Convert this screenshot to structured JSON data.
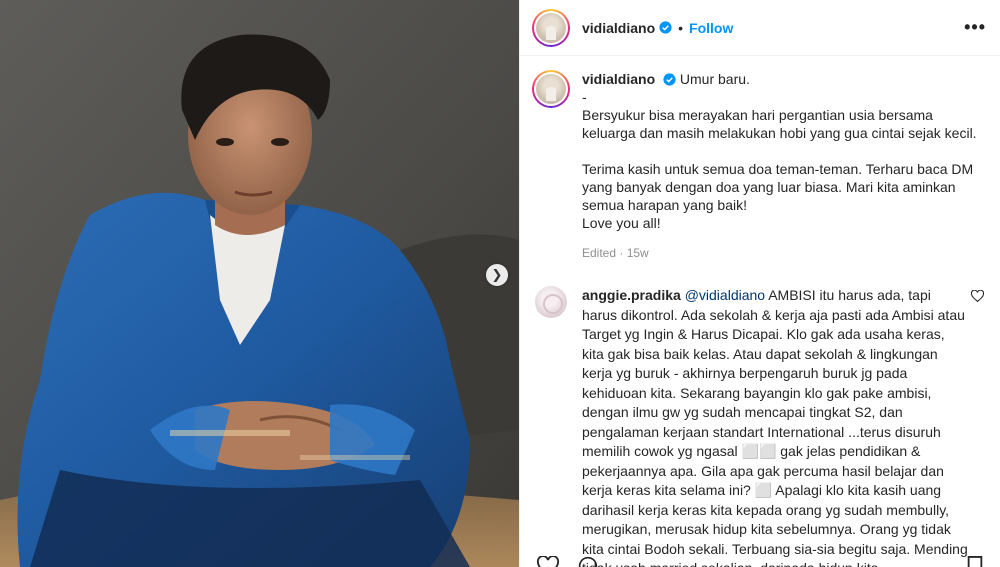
{
  "post": {
    "username": "vidialdiano",
    "follow_label": "Follow",
    "separator": "•",
    "more_label": "•••",
    "caption": {
      "first_line": "Umur baru.",
      "dash": "-",
      "para1": "Bersyukur bisa merayakan hari pergantian usia bersama keluarga dan masih melakukan hobi yang gua cintai sejak kecil.",
      "para2": "Terima kasih untuk semua doa teman-teman. Terharu baca DM yang banyak dengan doa yang luar biasa. Mari kita aminkan semua harapan yang baik!",
      "para3": "Love you all!"
    },
    "meta": "Edited · 15w"
  },
  "comment": {
    "username": "anggie.pradika",
    "mention": "@vidialdiano",
    "text": " AMBISI itu harus ada, tapi harus dikontrol. Ada sekolah & kerja aja pasti ada Ambisi atau Target yg Ingin & Harus Dicapai. Klo gak ada usaha keras, kita gak bisa baik kelas. Atau dapat sekolah & lingkungan kerja yg buruk - akhirnya berpengaruh buruk jg pada kehiduoan kita. Sekarang bayangin klo gak pake ambisi, dengan ilmu gw yg sudah mencapai tingkat S2, dan pengalaman kerjaan standart International ...terus disuruh memilih cowok yg ngasal ⬜⬜ gak jelas pendidikan & pekerjaannya apa. Gila apa gak percuma hasil belajar dan kerja keras kita selama ini? ⬜ Apalagi klo kita kasih uang darihasil kerja keras kita kepada orang yg sudah membully, merugikan, merusak hidup kita sebelumnya. Orang yg tidak kita cintai Bodoh sekali. Terbuang sia-sia begitu saja. Mending tidak usah married sekalian, daripada hidup kita"
  },
  "icons": {
    "next": "chevron-right-icon",
    "verified": "verified-badge-icon",
    "like": "heart-icon"
  },
  "colors": {
    "link": "#0095f6",
    "mention": "#00376b",
    "muted": "#8e8e8e"
  }
}
